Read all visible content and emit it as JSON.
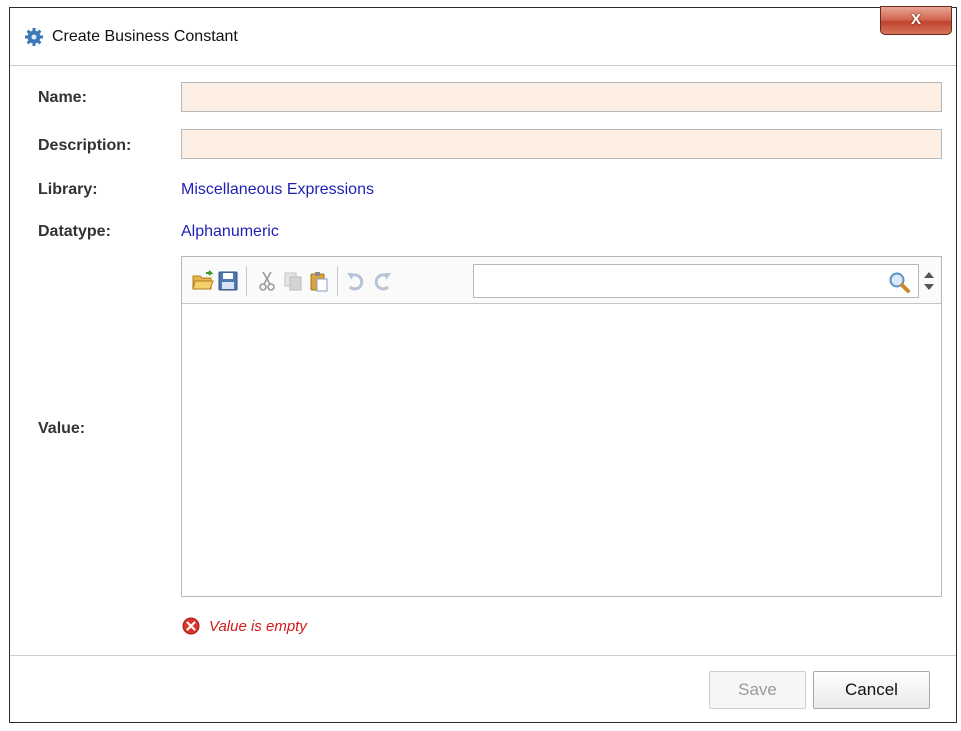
{
  "window": {
    "title": "Create Business Constant",
    "close_label": "X"
  },
  "form": {
    "name_label": "Name:",
    "name_value": "",
    "description_label": "Description:",
    "description_value": "",
    "library_label": "Library:",
    "library_value": "Miscellaneous Expressions",
    "datatype_label": "Datatype:",
    "datatype_value": "Alphanumeric",
    "value_label": "Value:"
  },
  "editor": {
    "toolbar_icons": [
      "open-folder-icon",
      "save-icon",
      "cut-icon",
      "copy-icon",
      "paste-icon",
      "undo-icon",
      "redo-icon",
      "search-icon",
      "up-down-spinner-icon"
    ],
    "search_value": "",
    "content": ""
  },
  "validation": {
    "error_message": "Value is empty",
    "error_icon": "error-circle-icon"
  },
  "footer": {
    "save_label": "Save",
    "cancel_label": "Cancel"
  },
  "colors": {
    "field_background": "#fdeee3",
    "value_link": "#1f1fb4",
    "error": "#d01a1a",
    "close_button": "#c0432e"
  }
}
